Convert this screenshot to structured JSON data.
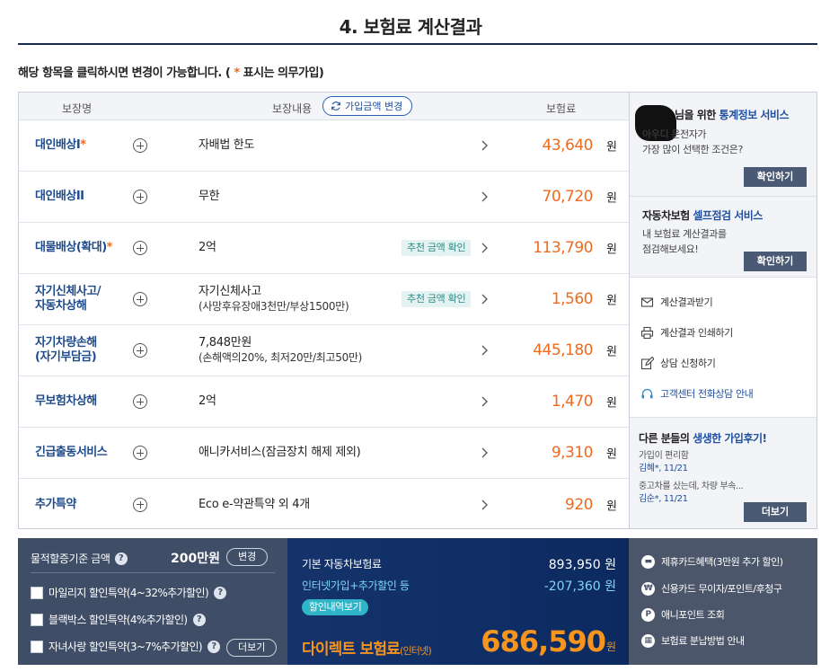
{
  "page": {
    "title": "4. 보험료 계산결과",
    "instruction_prefix": "해당 항목을 클릭하시면 변경이 가능합니다. (",
    "instruction_star": " * ",
    "instruction_suffix": "표시는 의무가입)"
  },
  "table": {
    "headers": {
      "name": "보장명",
      "content": "보장내용",
      "premium": "보험료"
    },
    "change_button": "가입금액 변경",
    "won": "원",
    "rows": [
      {
        "name": "대인배상I",
        "required": "*",
        "content": "자배법 한도",
        "content_sub": "",
        "badge": "",
        "premium": "43,640"
      },
      {
        "name": "대인배상II",
        "required": "",
        "content": "무한",
        "content_sub": "",
        "badge": "",
        "premium": "70,720"
      },
      {
        "name": "대물배상(확대)",
        "required": "*",
        "content": "2억",
        "content_sub": "",
        "badge": "추천 금액 확인",
        "premium": "113,790"
      },
      {
        "name": "자기신체사고/\n자동차상해",
        "required": "",
        "content": "자기신체사고",
        "content_sub": "(사망후유장애3천만/부상1500만)",
        "badge": "추천 금액 확인",
        "premium": "1,560"
      },
      {
        "name": "자기차량손해\n(자기부담금)",
        "required": "",
        "content": "7,848만원",
        "content_sub": "(손해액의20%, 최저20만/최고50만)",
        "badge": "",
        "premium": "445,180"
      },
      {
        "name": "무보험차상해",
        "required": "",
        "content": "2억",
        "content_sub": "",
        "badge": "",
        "premium": "1,470"
      },
      {
        "name": "긴급출동서비스",
        "required": "",
        "content": "애니카서비스(잠금장치 해제 제외)",
        "content_sub": "",
        "badge": "",
        "premium": "9,310"
      },
      {
        "name": "추가특약",
        "required": "",
        "content": "Eco e-약관특약 외 4개",
        "content_sub": "",
        "badge": "",
        "premium": "920"
      }
    ]
  },
  "sidebar": {
    "stats": {
      "title_prefix": "님을 위한 ",
      "title_highlight": "통계정보 서비스",
      "text": "아우디 운전자가\n가장 많이 선택한 조건은?",
      "button": "확인하기"
    },
    "self_check": {
      "title_prefix": "자동차보험 ",
      "title_highlight": "셀프점검 서비스",
      "text": "내 보험료 계산결과를\n점검해보세요!",
      "button": "확인하기"
    },
    "menu": [
      {
        "icon": "mail-icon",
        "label": "계산결과받기"
      },
      {
        "icon": "printer-icon",
        "label": "계산결과 인쇄하기"
      },
      {
        "icon": "edit-icon",
        "label": "상담 신청하기"
      },
      {
        "icon": "headset-icon",
        "label": "고객센터 전화상담 안내"
      }
    ],
    "reviews": {
      "title_prefix": "다른 분들의 ",
      "title_highlight": "생생한 가입후기!",
      "items": [
        {
          "text": "가입이 편리함",
          "who": "김혜*, 11/21"
        },
        {
          "text": "중고차를 샀는데, 차량 부속...",
          "who": "김순*, 11/21"
        }
      ],
      "more_button": "더보기"
    }
  },
  "bottom": {
    "left": {
      "property_label": "물적할증기준 금액",
      "property_amount": "200만원",
      "change_button": "변경",
      "checks": [
        "마일리지 할인특약(4~32%추가할인)",
        "블랙박스 할인특약(4%추가할인)",
        "자녀사랑 할인특약(3~7%추가할인)"
      ],
      "more_button": "더보기",
      "qmark": "?"
    },
    "middle": {
      "base_label": "기본 자동차보험료",
      "base_value": "893,950 원",
      "discount_label": "인터넷가입+추가할인 등",
      "discount_value": "-207,360 원",
      "discount_button": "할인내역보기",
      "final_label": "다이렉트 보험료",
      "final_label_sub": "(인터넷)",
      "final_value": "686,590",
      "final_won": "원"
    },
    "right": {
      "items": [
        {
          "icon": "card-icon",
          "glyph": "▬",
          "label": "제휴카드혜택(3만원 추가 할인)"
        },
        {
          "icon": "won-icon",
          "glyph": "₩",
          "label": "신용카드 무이자/포인트/후청구"
        },
        {
          "icon": "point-icon",
          "glyph": "P",
          "label": "애니포인트 조회"
        },
        {
          "icon": "installment-icon",
          "glyph": "▦",
          "label": "보험료 분납방법 안내"
        }
      ]
    }
  },
  "colors": {
    "accent_orange": "#f06a1d",
    "navy": "#1e4a8c",
    "teal_badge": "#2a8a86",
    "bottom_final": "#f7941d"
  }
}
